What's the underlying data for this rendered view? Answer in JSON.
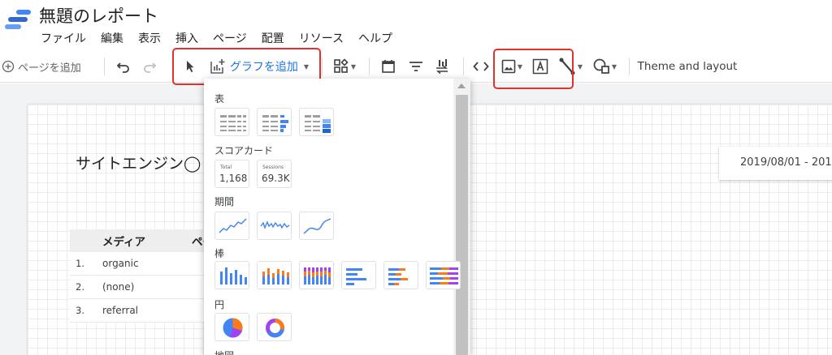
{
  "header": {
    "title": "無題のレポート",
    "menu": [
      "ファイル",
      "編集",
      "表示",
      "挿入",
      "ページ",
      "配置",
      "リソース",
      "ヘルプ"
    ]
  },
  "toolbar": {
    "add_page_label": "ページを追加",
    "add_chart_label": "グラフを追加",
    "theme_label": "Theme and layout"
  },
  "chart_menu": {
    "sections": {
      "table": "表",
      "scorecard": "スコアカード",
      "timeseries": "期間",
      "bar": "棒",
      "pie": "円",
      "geo": "地図"
    },
    "scorecards": [
      {
        "label": "Total",
        "value": "1,168"
      },
      {
        "label": "Sessions",
        "value": "69.3K"
      }
    ]
  },
  "canvas": {
    "site_title": "サイトエンジン◯",
    "date_range": "2019/08/01 - 201",
    "table": {
      "columns": [
        "メディア",
        "ペー"
      ],
      "rows": [
        {
          "index": "1.",
          "value": "organic"
        },
        {
          "index": "2.",
          "value": "(none)"
        },
        {
          "index": "3.",
          "value": "referral"
        }
      ]
    }
  },
  "colors": {
    "accent_blue": "#1a73e8",
    "highlight_red": "#e5312b",
    "chart_blue": "#4285f4",
    "chart_orange": "#fa7b17",
    "chart_purple": "#a142f4"
  },
  "icons": [
    "add-circle-icon",
    "undo-icon",
    "redo-icon",
    "pointer-icon",
    "add-chart-icon",
    "controls-icon",
    "calendar-icon",
    "filter-icon",
    "data-control-icon",
    "code-icon",
    "image-icon",
    "text-icon",
    "line-icon",
    "shape-icon"
  ]
}
